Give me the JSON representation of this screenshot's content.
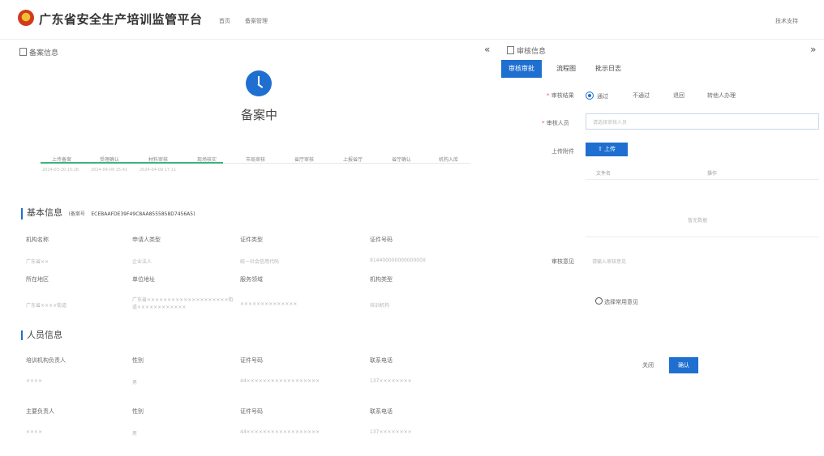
{
  "header": {
    "title": "广东省安全生产培训监管平台",
    "nav": [
      "首页",
      "备案管理"
    ],
    "support": "技术支持"
  },
  "left": {
    "panel_title": "备案信息",
    "status": "备案中",
    "steps": [
      "上传备案",
      "受理确认",
      "材料审核",
      "现场核实",
      "市局审核",
      "省厅审核",
      "上报省厅",
      "省厅确认",
      "机构入库"
    ],
    "step_times": [
      "2024-03-20 15:26",
      "2024-04-09 15:41",
      "2024-04-09 17:11"
    ],
    "basic_title": "基本信息",
    "record_label": "(备案号",
    "record_no": "ECEBAAFDE39F49C8AA8555858D7456A5)",
    "basic_headers": [
      "机构名称",
      "申请人类型",
      "证件类型",
      "证件号码",
      "所在地区",
      "单位地址",
      "服务领域",
      "机构类型"
    ],
    "basic_values": [
      "广东省××",
      "企业法人",
      "统一社会信用代码",
      "91440000000000000X",
      "广东省××××街道",
      "广东省××××××××××××××××××××街道××××××××××××",
      "××××××××××××××",
      "培训机构"
    ],
    "person_title": "人员信息",
    "person_rows": [
      {
        "headers": [
          "培训机构负责人",
          "性别",
          "证件号码",
          "联系电话"
        ],
        "values": [
          "××××",
          "男",
          "44××××××××××××××××××",
          "137××××××××"
        ]
      },
      {
        "headers": [
          "主要负责人",
          "性别",
          "证件号码",
          "联系电话"
        ],
        "values": [
          "××××",
          "男",
          "44××××××××××××××××××",
          "137××××××××"
        ]
      }
    ]
  },
  "right": {
    "panel_title": "审核信息",
    "tabs": [
      "审核审批",
      "流程图",
      "批示日志"
    ],
    "result_label": "审核结果",
    "result_options": [
      "通过",
      "不通过",
      "退回",
      "转他人办理"
    ],
    "approver_label": "审核人员",
    "approver_placeholder": "请选择审核人员",
    "upload_label": "上传附件",
    "upload_button": "上传",
    "file_headers": [
      "文件名",
      "操作"
    ],
    "no_data": "暂无数据",
    "opinion_label": "审核意见",
    "opinion_placeholder": "请输入审核意见",
    "common_opinion": "选择常用意见",
    "close": "关闭",
    "confirm": "确认"
  }
}
